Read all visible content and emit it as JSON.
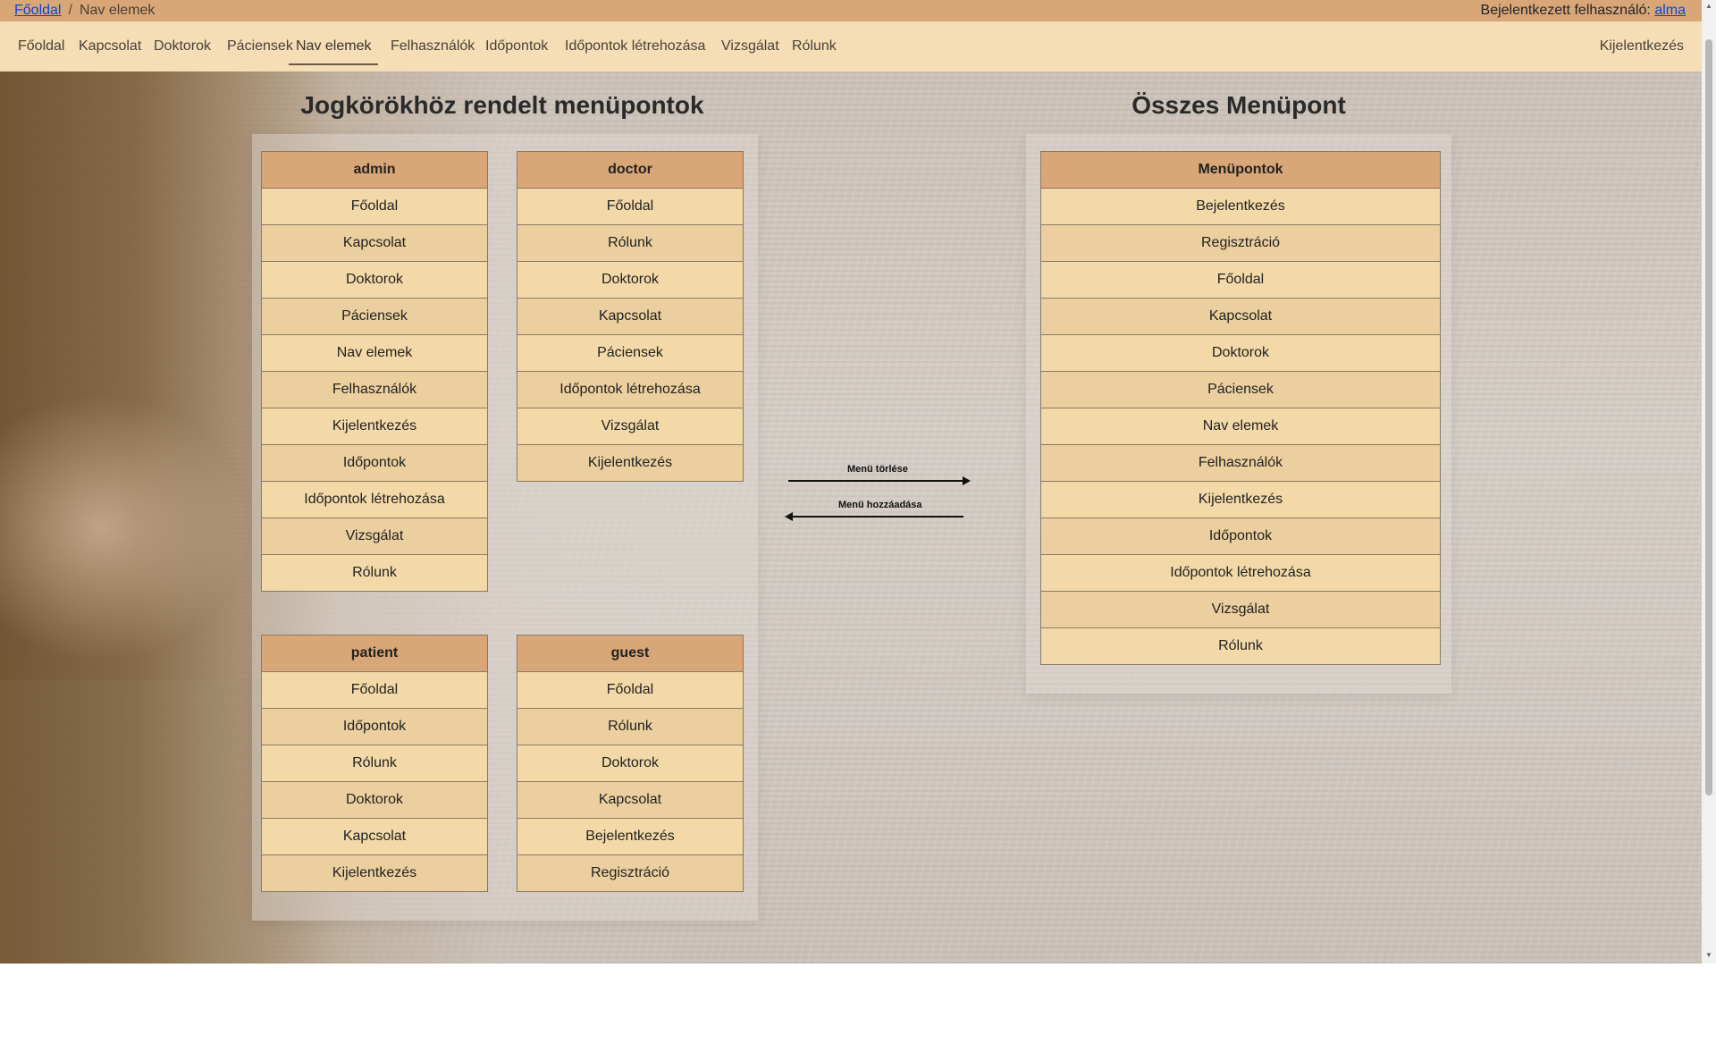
{
  "breadcrumb": {
    "home": "Főoldal",
    "separator": "/",
    "current": "Nav elemek"
  },
  "user": {
    "prefix": "Bejelentkezett felhasználó:",
    "name": "alma"
  },
  "nav": {
    "items": [
      "Főoldal",
      "Kapcsolat",
      "Doktorok",
      "Páciensek",
      "Nav elemek",
      "Felhasználók",
      "Időpontok",
      "Időpontok létrehozása",
      "Vizsgálat",
      "Rólunk"
    ],
    "active": "Nav elemek",
    "logout": "Kijelentkezés"
  },
  "left_heading": "Jogkörökhöz rendelt menüpontok",
  "right_heading": "Összes Menüpont",
  "roles": {
    "admin": {
      "title": "admin",
      "items": [
        "Főoldal",
        "Kapcsolat",
        "Doktorok",
        "Páciensek",
        "Nav elemek",
        "Felhasználók",
        "Kijelentkezés",
        "Időpontok",
        "Időpontok létrehozása",
        "Vizsgálat",
        "Rólunk"
      ]
    },
    "doctor": {
      "title": "doctor",
      "items": [
        "Főoldal",
        "Rólunk",
        "Doktorok",
        "Kapcsolat",
        "Páciensek",
        "Időpontok létrehozása",
        "Vizsgálat",
        "Kijelentkezés"
      ]
    },
    "patient": {
      "title": "patient",
      "items": [
        "Főoldal",
        "Időpontok",
        "Rólunk",
        "Doktorok",
        "Kapcsolat",
        "Kijelentkezés"
      ]
    },
    "guest": {
      "title": "guest",
      "items": [
        "Főoldal",
        "Rólunk",
        "Doktorok",
        "Kapcsolat",
        "Bejelentkezés",
        "Regisztráció"
      ]
    }
  },
  "all_menu": {
    "title": "Menüpontok",
    "items": [
      "Bejelentkezés",
      "Regisztráció",
      "Főoldal",
      "Kapcsolat",
      "Doktorok",
      "Páciensek",
      "Nav elemek",
      "Felhasználók",
      "Kijelentkezés",
      "Időpontok",
      "Időpontok létrehozása",
      "Vizsgálat",
      "Rólunk"
    ]
  },
  "arrows": {
    "delete_label": "Menü törlése",
    "add_label": "Menü hozzáadása"
  },
  "colors": {
    "topbar": "#d8a677",
    "navbar": "#f5deb5",
    "table_header": "#d8a677",
    "table_cell": "#f3d9a7",
    "link": "#0d47c9"
  }
}
